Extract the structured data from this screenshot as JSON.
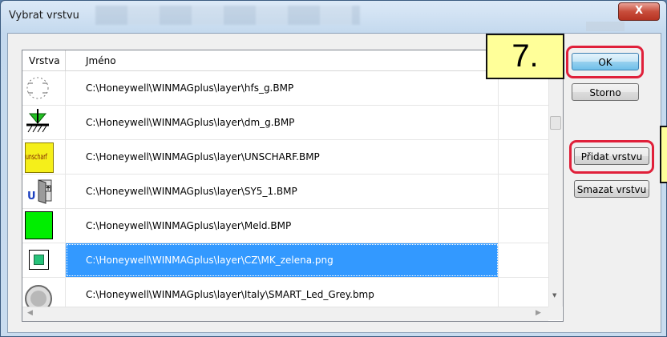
{
  "window": {
    "title": "Vybrat vrstvu",
    "close_label": "X"
  },
  "table": {
    "headers": {
      "layer": "Vrstva",
      "name": "Jméno"
    },
    "rows": [
      {
        "icon": "hfs-icon",
        "name": "C:\\Honeywell\\WINMAGplus\\layer\\hfs_g.BMP"
      },
      {
        "icon": "ground-arrow-icon",
        "name": "C:\\Honeywell\\WINMAGplus\\layer\\dm_g.BMP"
      },
      {
        "icon": "unscharf-icon",
        "name": "C:\\Honeywell\\WINMAGplus\\layer\\UNSCHARF.BMP",
        "icon_text": "unscharf"
      },
      {
        "icon": "door-u-icon",
        "name": "C:\\Honeywell\\WINMAGplus\\layer\\SY5_1.BMP"
      },
      {
        "icon": "green-square-icon",
        "name": "C:\\Honeywell\\WINMAGplus\\layer\\Meld.BMP"
      },
      {
        "icon": "small-green-square-icon",
        "name": "C:\\Honeywell\\WINMAGplus\\layer\\CZ\\MK_zelena.png",
        "selected": true
      },
      {
        "icon": "grey-led-icon",
        "name": "C:\\Honeywell\\WINMAGplus\\layer\\Italy\\SMART_Led_Grey.bmp"
      }
    ]
  },
  "buttons": {
    "ok": "OK",
    "cancel": "Storno",
    "add": "Přidat vrstvu",
    "remove": "Smazat vrstvu"
  },
  "callout": {
    "step": "7."
  },
  "colors": {
    "selection": "#3399ff",
    "highlight_ring": "#e0203a",
    "callout_bg": "#ffff99"
  }
}
